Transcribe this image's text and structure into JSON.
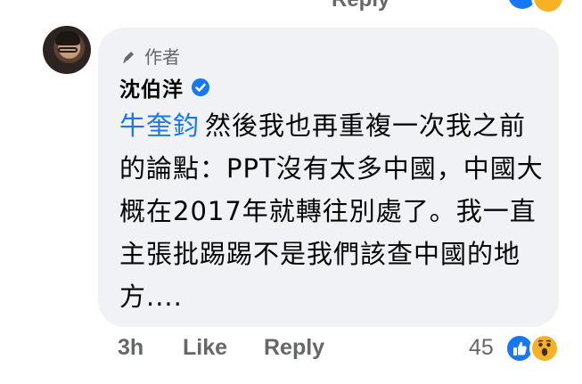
{
  "previous_comment": {
    "reply_label": "Reply"
  },
  "comment": {
    "author_tag": "作者",
    "author_name": "沈伯洋",
    "mention": "牛奎鈞",
    "text_after_mention": "然後我也再重複一次我之前的論點：PPT沒有太多中國，中國大概在2017年就轉往別處了。我一直主張批踢踢不是我們該查中國的地方....",
    "time": "3h",
    "like_label": "Like",
    "reply_label": "Reply",
    "reaction_count": "45"
  },
  "colors": {
    "bubble": "#f0f2f5",
    "mention": "#1877f2",
    "meta": "#65676b",
    "text": "#050505",
    "like_reaction": "#1877f2",
    "wow_reaction": "#f7b125"
  },
  "icons": {
    "author": "pencil-icon",
    "verified": "verified-badge-icon",
    "reaction_like": "thumbs-up-icon",
    "reaction_wow": "wow-face-icon"
  }
}
